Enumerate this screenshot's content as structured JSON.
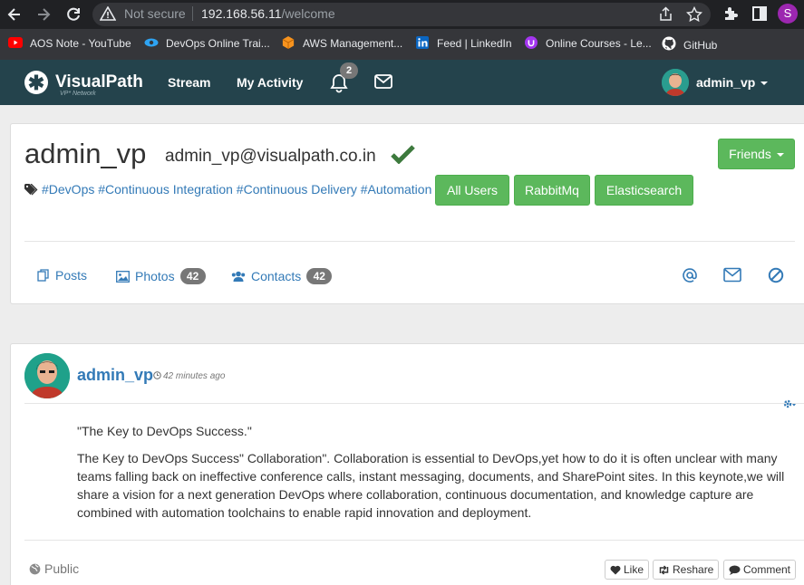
{
  "browser": {
    "security_label": "Not secure",
    "url_host": "192.168.56.11",
    "url_path": "/welcome",
    "profile_initial": "S",
    "bookmarks": [
      {
        "label": "AOS Note - YouTube",
        "icon": "youtube-icon",
        "color": "#ff0000"
      },
      {
        "label": "DevOps Online Trai...",
        "icon": "eye-logo-icon",
        "color": "#2ea3f2"
      },
      {
        "label": "AWS Management...",
        "icon": "aws-cube-icon",
        "color": "#f7931e"
      },
      {
        "label": "Feed | LinkedIn",
        "icon": "linkedin-icon",
        "color": "#0a66c2"
      },
      {
        "label": "Online Courses - Le...",
        "icon": "udemy-icon",
        "color": "#a435f0"
      },
      {
        "label": "GitHub",
        "icon": "github-icon",
        "color": "#ffffff"
      }
    ]
  },
  "navbar": {
    "brand": "VisualPath",
    "brand_sub": "VP* Network",
    "links": [
      "Stream",
      "My Activity"
    ],
    "notification_count": "2",
    "user_name": "admin_vp",
    "bg_color": "#24434c"
  },
  "profile": {
    "name": "admin_vp",
    "email": "admin_vp@visualpath.co.in",
    "tags": "#DevOps #Continuous Integration #Continuous Delivery #Automation",
    "groups": [
      "All Users",
      "RabbitMq",
      "Elasticsearch"
    ],
    "friends_label": "Friends",
    "tabs": [
      {
        "label": "Posts",
        "icon": "posts-icon"
      },
      {
        "label": "Photos",
        "icon": "image-icon",
        "count": "42"
      },
      {
        "label": "Contacts",
        "icon": "users-icon",
        "count": "42"
      }
    ],
    "actions": [
      "mention-icon",
      "mail-icon",
      "block-icon"
    ],
    "accent_green": "#5cb85c"
  },
  "post": {
    "author": "admin_vp",
    "time": "42 minutes ago",
    "title": "\"The Key to DevOps Success.\"",
    "body": "The Key to DevOps Success\" Collaboration\". Collaboration is essential to DevOps,yet how to do it is often unclear with many teams falling back on ineffective conference calls, instant messaging, documents, and SharePoint sites. In this keynote,we will share a vision for a next generation DevOps where collaboration, continuous documentation, and knowledge capture are combined with automation toolchains to enable rapid innovation and deployment.",
    "visibility": "Public",
    "like_label": "Like",
    "reshare_label": "Reshare",
    "comment_label": "Comment"
  }
}
